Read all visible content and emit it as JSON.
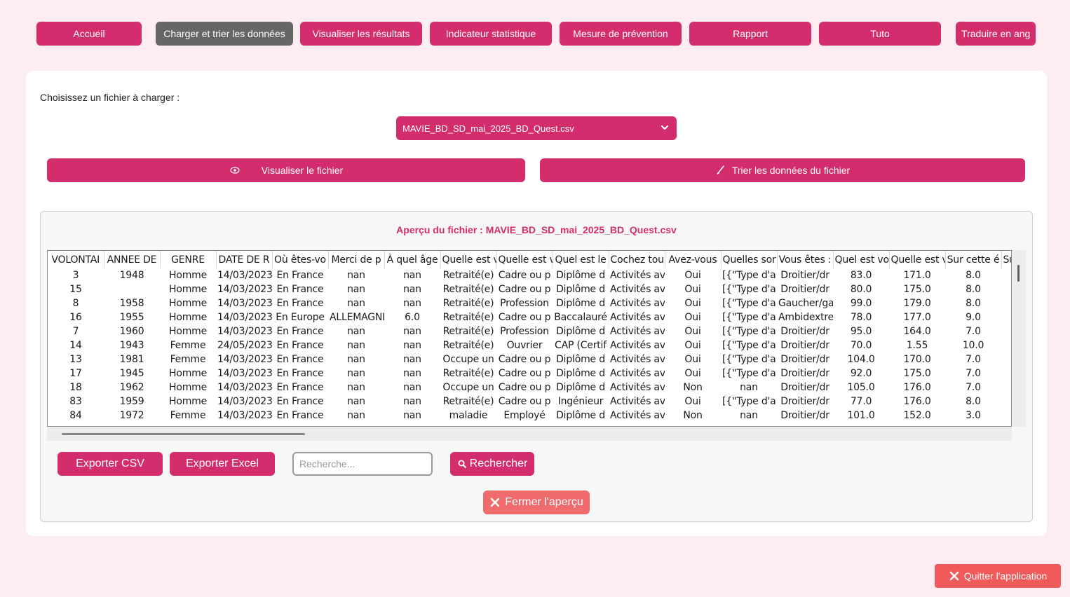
{
  "nav": {
    "items": [
      {
        "label": "Accueil"
      },
      {
        "label": "Charger et trier les données"
      },
      {
        "label": "Visualiser les résultats"
      },
      {
        "label": "Indicateur statistique"
      },
      {
        "label": "Mesure de prévention"
      },
      {
        "label": "Rapport"
      },
      {
        "label": "Tuto"
      },
      {
        "label": "Traduire en ang"
      }
    ],
    "active_index": 1
  },
  "loader": {
    "choose_label": "Choisissez un fichier à charger :",
    "selected_file": "MAVIE_BD_SD_mai_2025_BD_Quest.csv",
    "view_button": "Visualiser le fichier",
    "sort_button": "Trier les données du fichier"
  },
  "preview": {
    "title": "Aperçu du fichier : MAVIE_BD_SD_mai_2025_BD_Quest.csv",
    "columns": [
      "VOLONTAI",
      "ANNEE DE",
      "GENRE",
      "DATE DE R",
      "Où êtes-vo",
      "Merci de p",
      "À quel âge",
      "Quelle est v",
      "Quelle est v",
      "Quel est le",
      "Cochez tou",
      "Avez-vous",
      "Quelles sor",
      "Vous êtes :",
      "Quel est vo",
      "Quelle est v",
      "Sur cette é",
      "Su"
    ],
    "rows": [
      [
        "3",
        "1948",
        "Homme",
        "14/03/2023",
        "En France",
        "nan",
        "nan",
        "Retraité(e)",
        "Cadre ou p",
        "Diplôme d",
        "Activités av",
        "Oui",
        "[{\"Type d'a",
        "Droitier/dr",
        "83.0",
        "171.0",
        "8.0",
        ""
      ],
      [
        "15",
        "",
        "Homme",
        "14/03/2023",
        "En France",
        "nan",
        "nan",
        "Retraité(e)",
        "Cadre ou p",
        "Diplôme d",
        "Activités av",
        "Oui",
        "[{\"Type d'a",
        "Droitier/dr",
        "80.0",
        "175.0",
        "8.0",
        ""
      ],
      [
        "8",
        "1958",
        "Homme",
        "14/03/2023",
        "En France",
        "nan",
        "nan",
        "Retraité(e)",
        "Profession",
        "Diplôme d",
        "Activités av",
        "Oui",
        "[{\"Type d'a",
        "Gaucher/ga",
        "99.0",
        "179.0",
        "8.0",
        ""
      ],
      [
        "16",
        "1955",
        "Homme",
        "14/03/2023",
        "En Europe",
        "ALLEMAGNE",
        "6.0",
        "Retraité(e)",
        "Cadre ou p",
        "Baccalauré",
        "Activités av",
        "Oui",
        "[{\"Type d'a",
        "Ambidextre",
        "78.0",
        "177.0",
        "9.0",
        ""
      ],
      [
        "7",
        "1960",
        "Homme",
        "14/03/2023",
        "En France",
        "nan",
        "nan",
        "Retraité(e)",
        "Profession",
        "Diplôme d",
        "Activités av",
        "Oui",
        "[{\"Type d'a",
        "Droitier/dr",
        "95.0",
        "164.0",
        "7.0",
        ""
      ],
      [
        "14",
        "1943",
        "Femme",
        "24/05/2023",
        "En France",
        "nan",
        "nan",
        "Retraité(e)",
        "Ouvrier",
        "CAP (Certif",
        "Activités av",
        "Oui",
        "[{\"Type d'a",
        "Droitier/dr",
        "70.0",
        "1.55",
        "10.0",
        ""
      ],
      [
        "13",
        "1981",
        "Femme",
        "14/03/2023",
        "En France",
        "nan",
        "nan",
        "Occupe un",
        "Cadre ou p",
        "Diplôme d",
        "Activités av",
        "Oui",
        "[{\"Type d'a",
        "Droitier/dr",
        "104.0",
        "170.0",
        "7.0",
        ""
      ],
      [
        "17",
        "1945",
        "Homme",
        "14/03/2023",
        "En France",
        "nan",
        "nan",
        "Retraité(e)",
        "Cadre ou p",
        "Diplôme d",
        "Activités av",
        "Oui",
        "[{\"Type d'a",
        "Droitier/dr",
        "92.0",
        "175.0",
        "7.0",
        ""
      ],
      [
        "18",
        "1962",
        "Homme",
        "14/03/2023",
        "En France",
        "nan",
        "nan",
        "Occupe un",
        "Cadre ou p",
        "Diplôme d",
        "Activités av",
        "Non",
        "nan",
        "Droitier/dr",
        "105.0",
        "176.0",
        "7.0",
        ""
      ],
      [
        "83",
        "1959",
        "Homme",
        "14/03/2023",
        "En France",
        "nan",
        "nan",
        "Retraité(e)",
        "Cadre ou p",
        "Ingénieur",
        "Activités av",
        "Oui",
        "[{\"Type d'a",
        "Droitier/dr",
        "77.0",
        "176.0",
        "8.0",
        ""
      ],
      [
        "84",
        "1972",
        "Femme",
        "14/03/2023",
        "En France",
        "nan",
        "nan",
        "maladie",
        "Employé",
        "Diplôme d",
        "Activités av",
        "Non",
        "nan",
        "Droitier/dr",
        "101.0",
        "152.0",
        "3.0",
        ""
      ]
    ],
    "export_csv": "Exporter CSV",
    "export_excel": "Exporter Excel",
    "search_placeholder": "Recherche...",
    "search_button": "Rechercher",
    "close_button": "Fermer l'aperçu"
  },
  "quit_button": "Quitter l'application",
  "colors": {
    "accent": "#d42d6d",
    "active_nav": "#666666",
    "background": "#fdecf1",
    "danger": "#f05a5a"
  },
  "icons": {
    "view": "eye-icon",
    "sort": "brush-icon",
    "search": "magnifier-icon",
    "close": "close-icon",
    "dropdown": "chevron-down-icon"
  }
}
